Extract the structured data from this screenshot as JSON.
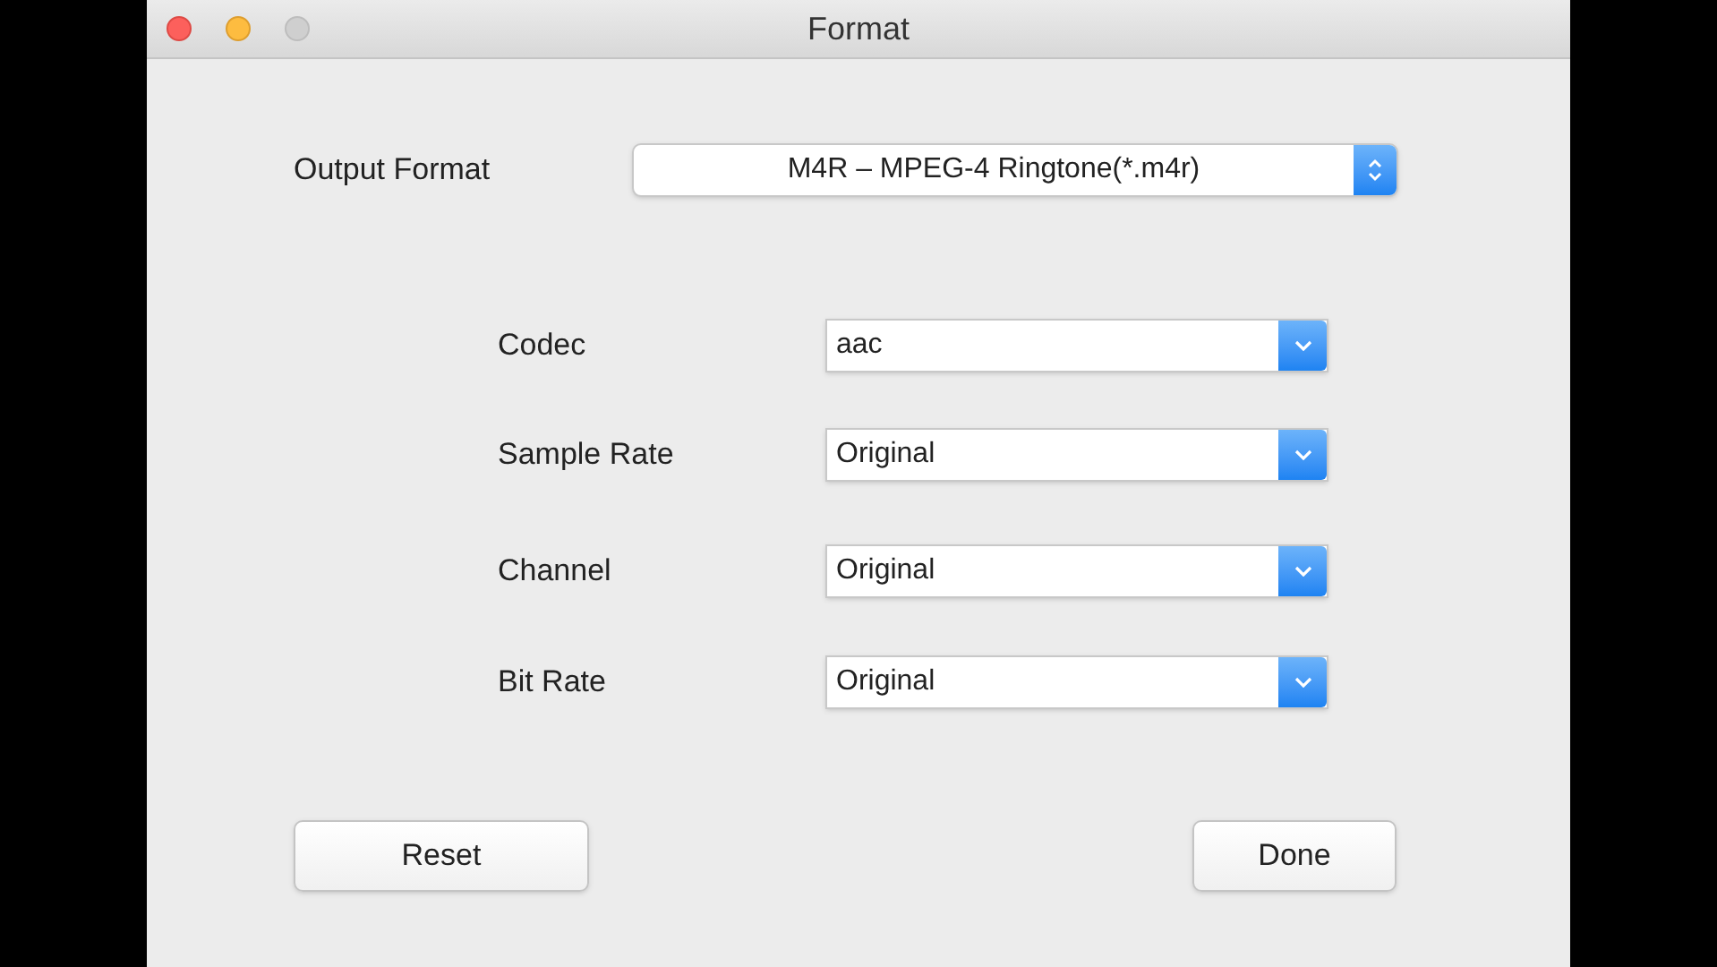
{
  "window": {
    "title": "Format"
  },
  "output_format": {
    "label": "Output Format",
    "value": "M4R – MPEG-4 Ringtone(*.m4r)"
  },
  "settings": [
    {
      "label": "Codec",
      "value": "aac"
    },
    {
      "label": "Sample Rate",
      "value": "Original"
    },
    {
      "label": "Channel",
      "value": "Original"
    },
    {
      "label": "Bit Rate",
      "value": "Original"
    }
  ],
  "buttons": [
    "Reset",
    "Done"
  ]
}
